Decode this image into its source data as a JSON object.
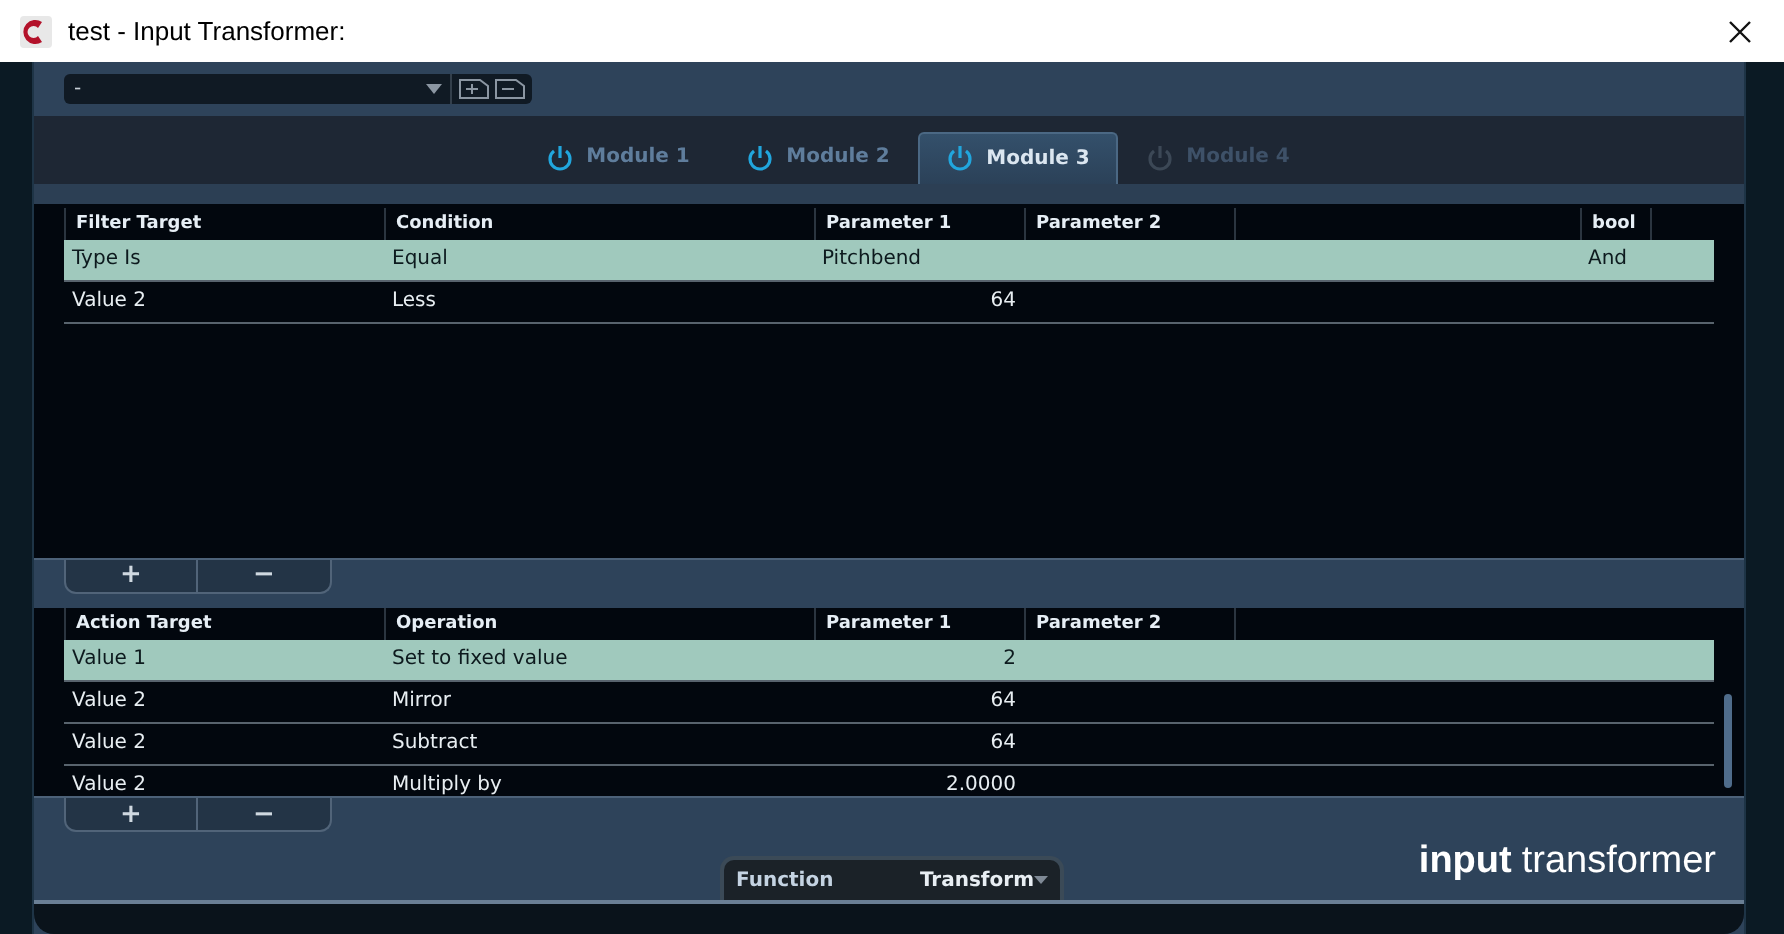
{
  "window": {
    "title": "test - Input Transformer:"
  },
  "preset": {
    "value": "-"
  },
  "modules": [
    {
      "label": "Module 1",
      "selected": false,
      "on": true
    },
    {
      "label": "Module 2",
      "selected": false,
      "on": true
    },
    {
      "label": "Module 3",
      "selected": true,
      "on": true
    },
    {
      "label": "Module 4",
      "selected": false,
      "on": false
    }
  ],
  "filter_table": {
    "columns": [
      "Filter Target",
      "Condition",
      "Parameter 1",
      "Parameter 2",
      "",
      "bool",
      ""
    ],
    "rows": [
      {
        "cells": [
          "Type Is",
          "Equal",
          "Pitchbend",
          "",
          "",
          "And",
          ""
        ],
        "kind": "name",
        "selected": true
      },
      {
        "cells": [
          "Value 2",
          "Less",
          "64",
          "",
          "",
          "",
          ""
        ],
        "kind": "value",
        "selected": false
      }
    ]
  },
  "filter_buttons": [
    "+",
    "−"
  ],
  "action_table": {
    "columns": [
      "Action Target",
      "Operation",
      "Parameter 1",
      "Parameter 2",
      ""
    ],
    "rows": [
      {
        "cells": [
          "Value 1",
          "Set to fixed value",
          "2",
          "",
          ""
        ],
        "kind": "value",
        "selected": true
      },
      {
        "cells": [
          "Value 2",
          "Mirror",
          "64",
          "",
          ""
        ],
        "kind": "value",
        "selected": false
      },
      {
        "cells": [
          "Value 2",
          "Subtract",
          "64",
          "",
          ""
        ],
        "kind": "value",
        "selected": false
      },
      {
        "cells": [
          "Value 2",
          "Multiply by",
          "2.0000",
          "",
          ""
        ],
        "kind": "value",
        "selected": false
      }
    ]
  },
  "action_buttons": [
    "+",
    "−"
  ],
  "function": {
    "label": "Function",
    "value": "Transform"
  },
  "brand": {
    "strong": "input",
    "light": "transformer"
  }
}
